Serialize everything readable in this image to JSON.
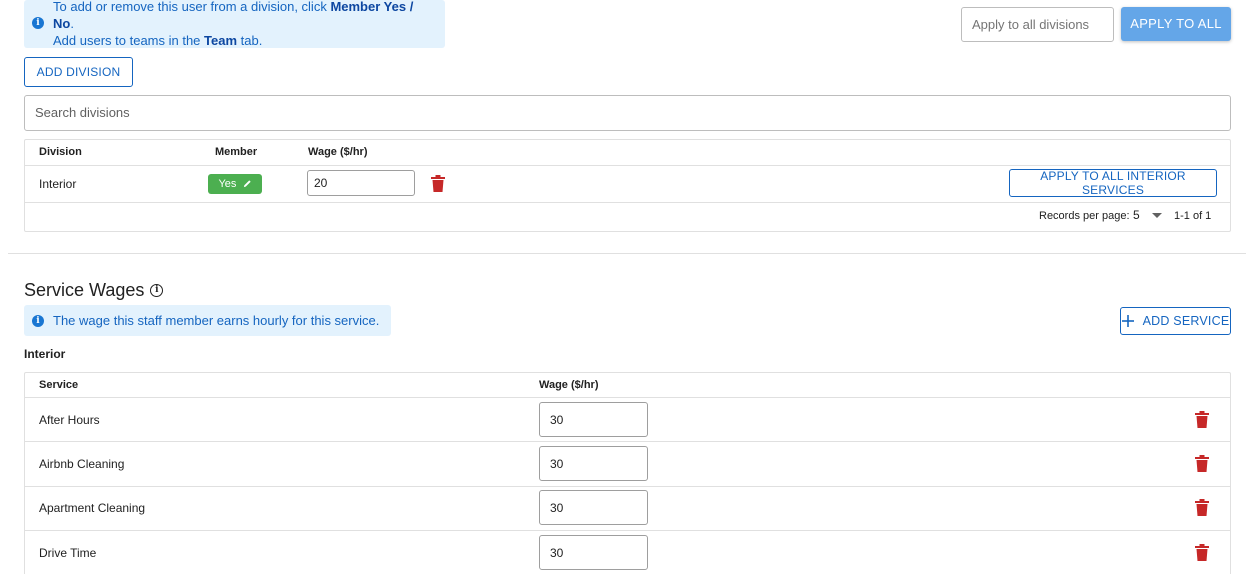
{
  "division_notice": {
    "line1_prefix": "To add or remove this user from a division, click ",
    "line1_bold": "Member Yes / No",
    "line1_suffix": ".",
    "line2_prefix": "Add users to teams in the ",
    "line2_bold": "Team",
    "line2_suffix": " tab."
  },
  "apply_divisions": {
    "placeholder": "Apply to all divisions",
    "button_label": "APPLY TO ALL"
  },
  "add_division_label": "ADD DIVISION",
  "search": {
    "placeholder": "Search divisions"
  },
  "divisions_table": {
    "headers": {
      "division": "Division",
      "member": "Member",
      "wage": "Wage ($/hr)"
    },
    "rows": [
      {
        "division": "Interior",
        "member": "Yes",
        "wage": "20",
        "apply_label": "APPLY TO ALL INTERIOR SERVICES"
      }
    ],
    "pagination": {
      "records_label": "Records per page:",
      "per_page": "5",
      "range": "1-1 of 1"
    }
  },
  "service_wages": {
    "title": "Service Wages",
    "notice": "The wage this staff member earns hourly for this service.",
    "add_service_label": "ADD SERVICE",
    "group_title": "Interior",
    "headers": {
      "service": "Service",
      "wage": "Wage ($/hr)"
    },
    "rows": [
      {
        "service": "After Hours",
        "wage": "30"
      },
      {
        "service": "Airbnb Cleaning",
        "wage": "30"
      },
      {
        "service": "Apartment Cleaning",
        "wage": "30"
      },
      {
        "service": "Drive Time",
        "wage": "30"
      }
    ]
  },
  "colors": {
    "primary": "#1565c0",
    "info_bg": "#e3f2fd",
    "success": "#4caf50",
    "danger": "#c62828",
    "apply_button": "#64a6e8"
  },
  "icons": {
    "info": "info-icon",
    "edit": "pencil-icon",
    "delete": "trash-icon",
    "dropdown": "caret-down-icon",
    "add": "plus-icon"
  }
}
